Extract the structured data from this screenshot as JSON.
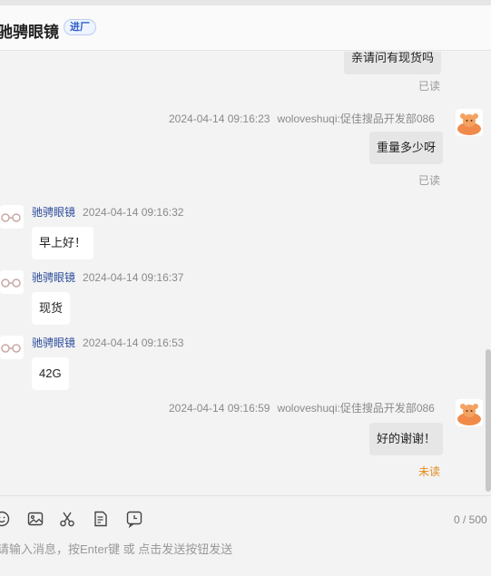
{
  "header": {
    "shop_name": "驰骋眼镜",
    "badge": "进厂"
  },
  "messages": [
    {
      "side": "right",
      "text": "亲请问有现货吗",
      "status": "已读"
    },
    {
      "side": "right",
      "time": "2024-04-14 09:16:23",
      "sender": "woloveshuqi:促佳搜品开发部086",
      "text": "重量多少呀",
      "status": "已读"
    },
    {
      "side": "left",
      "sender": "驰骋眼镜",
      "time": "2024-04-14 09:16:32",
      "text": "早上好！"
    },
    {
      "side": "left",
      "sender": "驰骋眼镜",
      "time": "2024-04-14 09:16:37",
      "text": "现货"
    },
    {
      "side": "left",
      "sender": "驰骋眼镜",
      "time": "2024-04-14 09:16:53",
      "text": "42G"
    },
    {
      "side": "right",
      "time": "2024-04-14 09:16:59",
      "sender": "woloveshuqi:促佳搜品开发部086",
      "text": "好的谢谢！",
      "status": "未读"
    }
  ],
  "toolbar": {
    "icons": [
      "emoji-icon",
      "image-icon",
      "scissors-icon",
      "document-icon",
      "history-icon"
    ],
    "counter": "0 / 500",
    "input_placeholder": "请输入消息，按Enter键 或 点击发送按钮发送"
  },
  "colors": {
    "unread": "#e28a1a",
    "sender": "#2b4b9a",
    "badge": "#2f5fc8"
  }
}
